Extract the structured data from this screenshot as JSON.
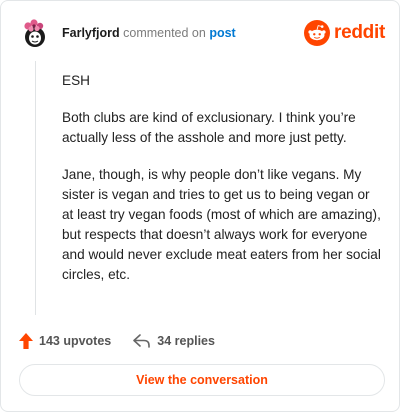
{
  "header": {
    "username": "Farlyfjord",
    "verb": "commented on",
    "target": "post",
    "brand": "reddit"
  },
  "comment": {
    "paragraphs": [
      "ESH",
      "Both clubs are kind of exclusionary. I think you’re actually less of the asshole and more just petty.",
      "Jane, though, is why people don’t like vegans. My sister is vegan and tries to get us to being vegan or at least try vegan foods (most of which are amazing), but respects that doesn’t always work for everyone and would never exclude meat eaters from her social circles, etc."
    ]
  },
  "actions": {
    "upvotes": "143 upvotes",
    "replies": "34 replies"
  },
  "cta": {
    "label": "View the conversation"
  },
  "colors": {
    "accent": "#ff4500",
    "link": "#0079d3"
  }
}
